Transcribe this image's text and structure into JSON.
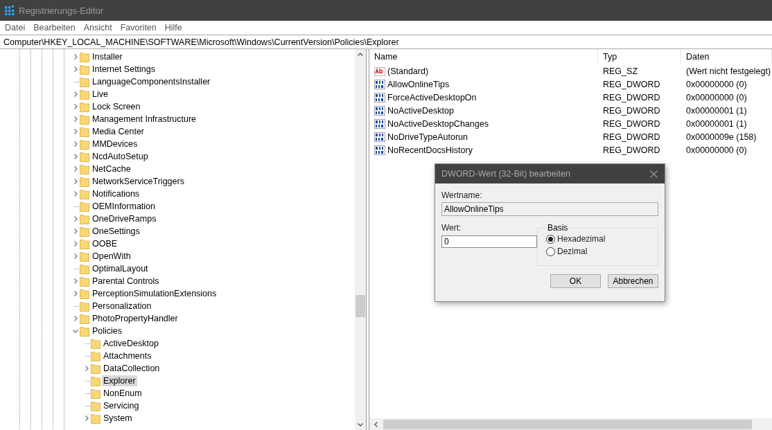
{
  "window": {
    "title": "Registrierungs-Editor"
  },
  "menu": [
    "Datei",
    "Bearbeiten",
    "Ansicht",
    "Favoriten",
    "Hilfe"
  ],
  "address": "Computer\\HKEY_LOCAL_MACHINE\\SOFTWARE\\Microsoft\\Windows\\CurrentVersion\\Policies\\Explorer",
  "tree": [
    {
      "label": "Installer",
      "expandable": true,
      "expanded": false,
      "selected": false
    },
    {
      "label": "Internet Settings",
      "expandable": true,
      "expanded": false,
      "selected": false
    },
    {
      "label": "LanguageComponentsInstaller",
      "expandable": false,
      "selected": false
    },
    {
      "label": "Live",
      "expandable": true,
      "expanded": false,
      "selected": false
    },
    {
      "label": "Lock Screen",
      "expandable": true,
      "expanded": false,
      "selected": false
    },
    {
      "label": "Management Infrastructure",
      "expandable": true,
      "expanded": false,
      "selected": false
    },
    {
      "label": "Media Center",
      "expandable": true,
      "expanded": false,
      "selected": false
    },
    {
      "label": "MMDevices",
      "expandable": true,
      "expanded": false,
      "selected": false
    },
    {
      "label": "NcdAutoSetup",
      "expandable": true,
      "expanded": false,
      "selected": false
    },
    {
      "label": "NetCache",
      "expandable": true,
      "expanded": false,
      "selected": false
    },
    {
      "label": "NetworkServiceTriggers",
      "expandable": true,
      "expanded": false,
      "selected": false
    },
    {
      "label": "Notifications",
      "expandable": true,
      "expanded": false,
      "selected": false
    },
    {
      "label": "OEMInformation",
      "expandable": false,
      "selected": false
    },
    {
      "label": "OneDriveRamps",
      "expandable": true,
      "expanded": false,
      "selected": false
    },
    {
      "label": "OneSettings",
      "expandable": true,
      "expanded": false,
      "selected": false
    },
    {
      "label": "OOBE",
      "expandable": true,
      "expanded": false,
      "selected": false
    },
    {
      "label": "OpenWith",
      "expandable": true,
      "expanded": false,
      "selected": false
    },
    {
      "label": "OptimalLayout",
      "expandable": false,
      "selected": false
    },
    {
      "label": "Parental Controls",
      "expandable": true,
      "expanded": false,
      "selected": false
    },
    {
      "label": "PerceptionSimulationExtensions",
      "expandable": true,
      "expanded": false,
      "selected": false
    },
    {
      "label": "Personalization",
      "expandable": false,
      "selected": false
    },
    {
      "label": "PhotoPropertyHandler",
      "expandable": true,
      "expanded": false,
      "selected": false
    },
    {
      "label": "Policies",
      "expandable": true,
      "expanded": true,
      "selected": false,
      "children": [
        {
          "label": "ActiveDesktop",
          "expandable": false,
          "selected": false
        },
        {
          "label": "Attachments",
          "expandable": false,
          "selected": false
        },
        {
          "label": "DataCollection",
          "expandable": true,
          "expanded": false,
          "selected": false
        },
        {
          "label": "Explorer",
          "expandable": false,
          "selected": true
        },
        {
          "label": "NonEnum",
          "expandable": false,
          "selected": false
        },
        {
          "label": "Servicing",
          "expandable": false,
          "selected": false
        },
        {
          "label": "System",
          "expandable": true,
          "expanded": false,
          "selected": false
        }
      ]
    }
  ],
  "values": {
    "columns": [
      "Name",
      "Typ",
      "Daten"
    ],
    "rows": [
      {
        "kind": "string",
        "name": "(Standard)",
        "type": "REG_SZ",
        "data": "(Wert nicht festgelegt)"
      },
      {
        "kind": "dword",
        "name": "AllowOnlineTips",
        "type": "REG_DWORD",
        "data": "0x00000000 (0)"
      },
      {
        "kind": "dword",
        "name": "ForceActiveDesktopOn",
        "type": "REG_DWORD",
        "data": "0x00000000 (0)"
      },
      {
        "kind": "dword",
        "name": "NoActiveDesktop",
        "type": "REG_DWORD",
        "data": "0x00000001 (1)"
      },
      {
        "kind": "dword",
        "name": "NoActiveDesktopChanges",
        "type": "REG_DWORD",
        "data": "0x00000001 (1)"
      },
      {
        "kind": "dword",
        "name": "NoDriveTypeAutorun",
        "type": "REG_DWORD",
        "data": "0x0000009e (158)"
      },
      {
        "kind": "dword",
        "name": "NoRecentDocsHistory",
        "type": "REG_DWORD",
        "data": "0x00000000 (0)"
      }
    ]
  },
  "dialog": {
    "title": "DWORD-Wert (32-Bit) bearbeiten",
    "name_label": "Wertname:",
    "name_value": "AllowOnlineTips",
    "value_label": "Wert:",
    "value": "0",
    "base_label": "Basis",
    "bases": [
      {
        "label": "Hexadezimal",
        "selected": true
      },
      {
        "label": "Dezimal",
        "selected": false
      }
    ],
    "buttons": [
      "OK",
      "Abbrechen"
    ]
  }
}
